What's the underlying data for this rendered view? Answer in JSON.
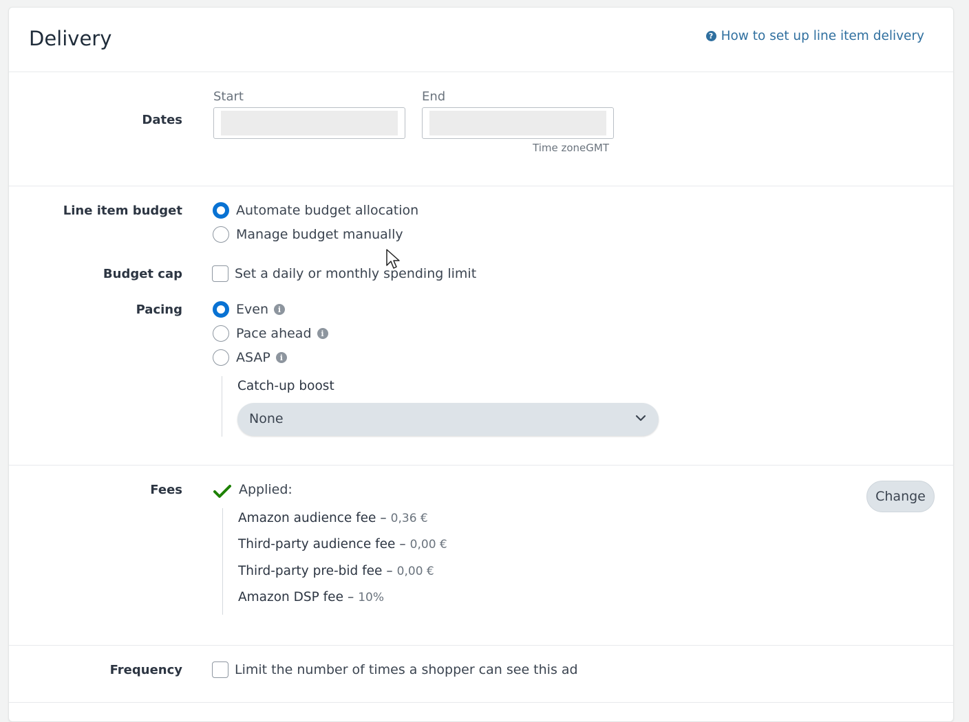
{
  "header": {
    "title": "Delivery",
    "help_link": "How to set up line item delivery"
  },
  "dates": {
    "label": "Dates",
    "start_label": "Start",
    "end_label": "End",
    "timezone": "Time zoneGMT"
  },
  "budget": {
    "label": "Line item budget",
    "options": [
      {
        "label": "Automate budget allocation",
        "selected": true
      },
      {
        "label": "Manage budget manually",
        "selected": false
      }
    ]
  },
  "budget_cap": {
    "label": "Budget cap",
    "checkbox_label": "Set a daily or monthly spending limit",
    "checked": false
  },
  "pacing": {
    "label": "Pacing",
    "options": [
      {
        "label": "Even",
        "selected": true
      },
      {
        "label": "Pace ahead",
        "selected": false
      },
      {
        "label": "ASAP",
        "selected": false
      }
    ],
    "boost_label": "Catch-up boost",
    "boost_value": "None"
  },
  "fees": {
    "label": "Fees",
    "applied": "Applied:",
    "items": [
      {
        "name": "Amazon audience fee",
        "amount": "0,36 €"
      },
      {
        "name": "Third-party audience fee",
        "amount": "0,00 €"
      },
      {
        "name": "Third-party pre-bid fee",
        "amount": "0,00 €"
      },
      {
        "name": "Amazon DSP fee",
        "amount": "10%"
      }
    ],
    "change_label": "Change"
  },
  "frequency": {
    "label": "Frequency",
    "checkbox_label": "Limit the number of times a shopper can see this ad",
    "checked": false
  },
  "colors": {
    "accent": "#0972d3",
    "link": "#2f6f9f",
    "success": "#1d8102"
  }
}
